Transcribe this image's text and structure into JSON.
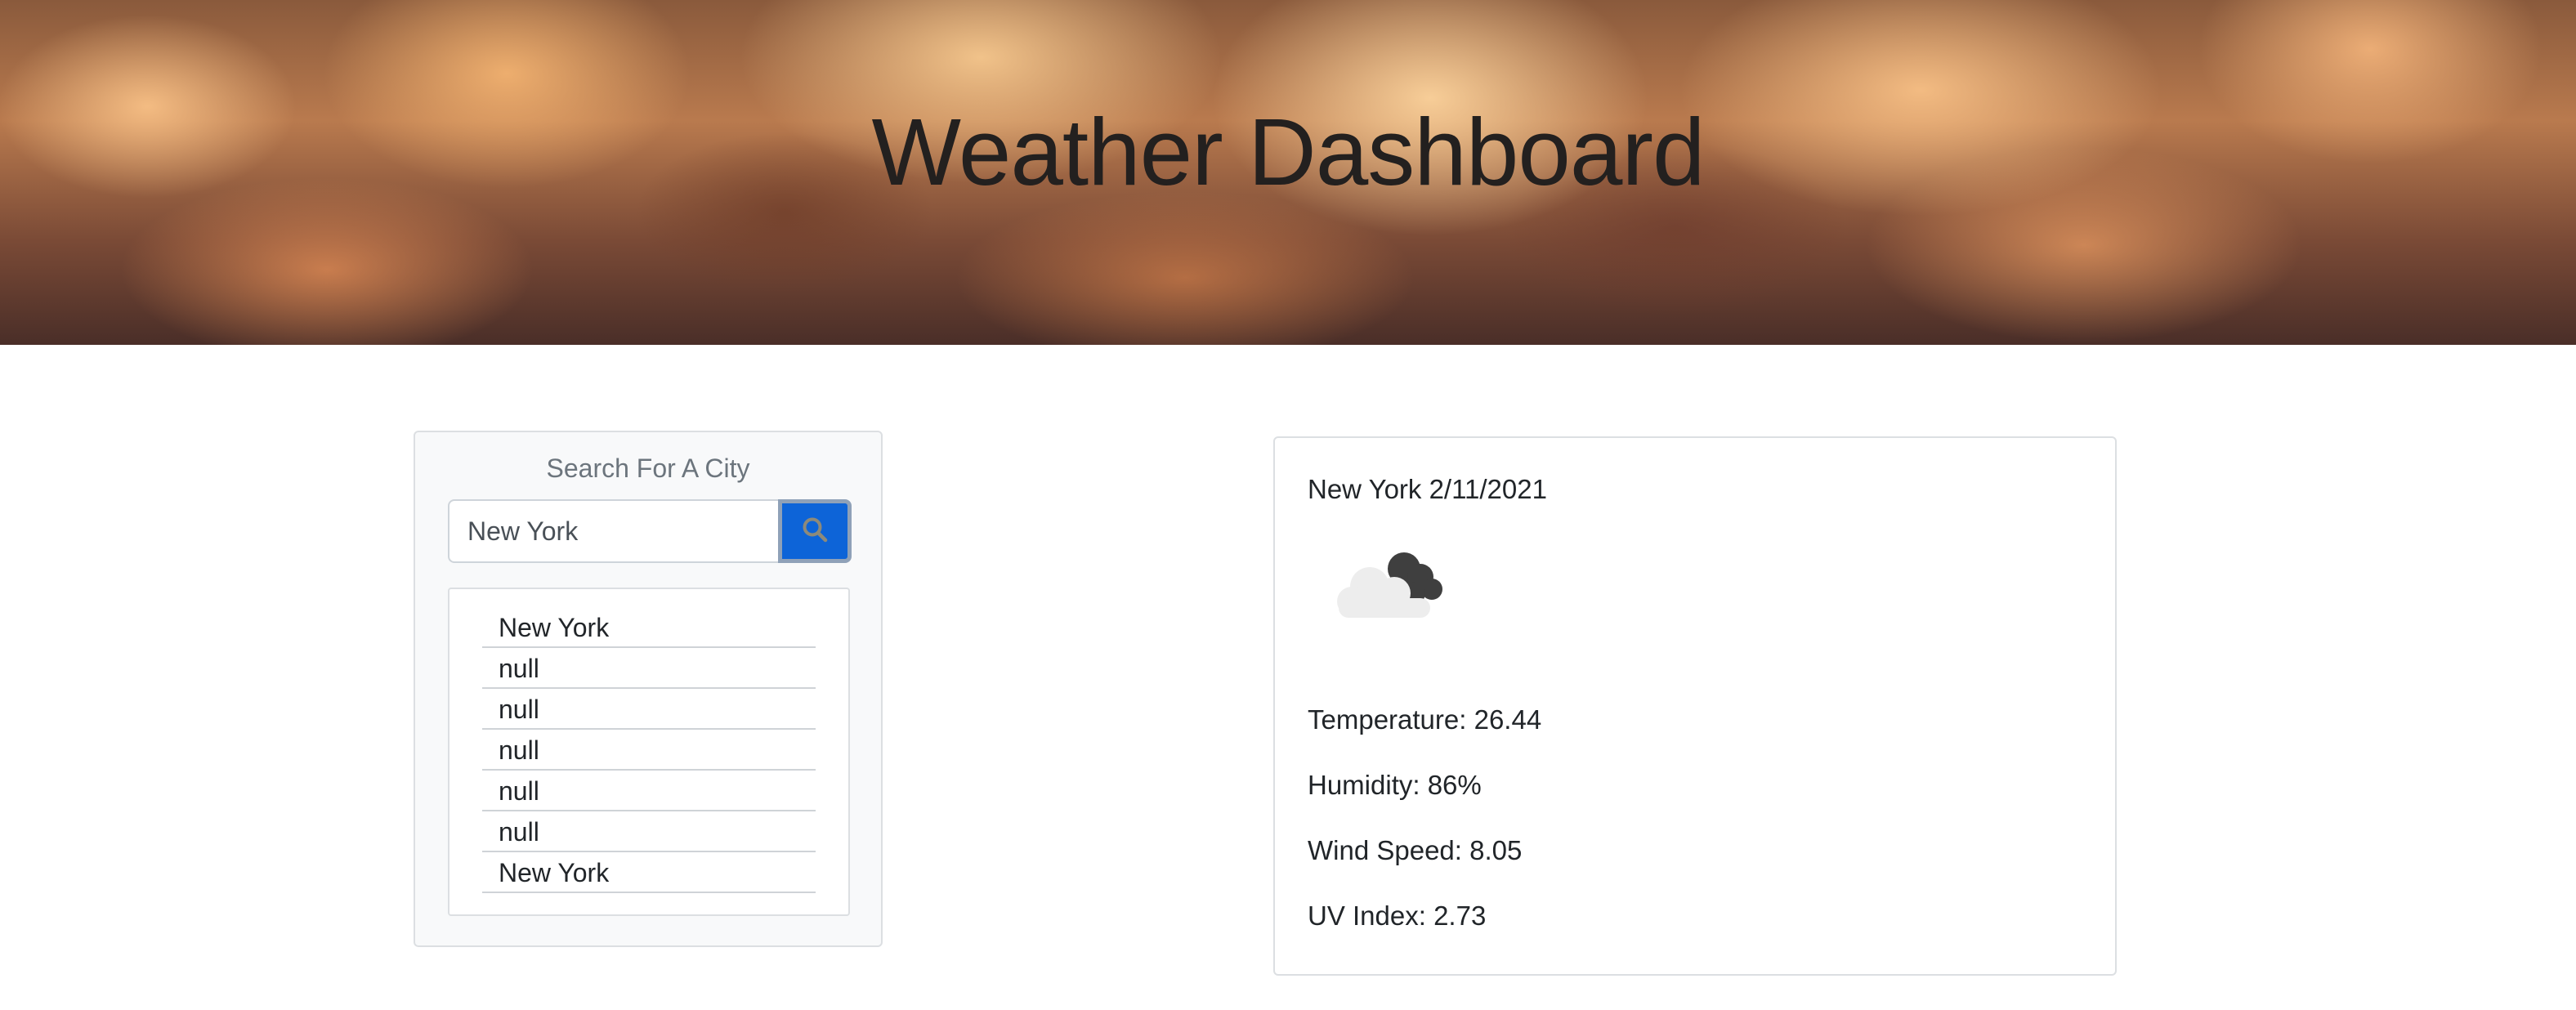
{
  "header": {
    "title": "Weather Dashboard"
  },
  "search": {
    "heading": "Search For A City",
    "input_value": "New York",
    "button_icon": "search-icon",
    "button_color": "#0d64d8"
  },
  "history": {
    "items": [
      "New York",
      "null",
      "null",
      "null",
      "null",
      "null",
      "New York"
    ]
  },
  "current_weather": {
    "city_date": "New York 2/11/2021",
    "icon": "partly-cloudy-icon",
    "temperature": "Temperature: 26.44",
    "humidity": "Humidity: 86%",
    "wind_speed": "Wind Speed: 8.05",
    "uv_index": "UV Index: 2.73"
  }
}
